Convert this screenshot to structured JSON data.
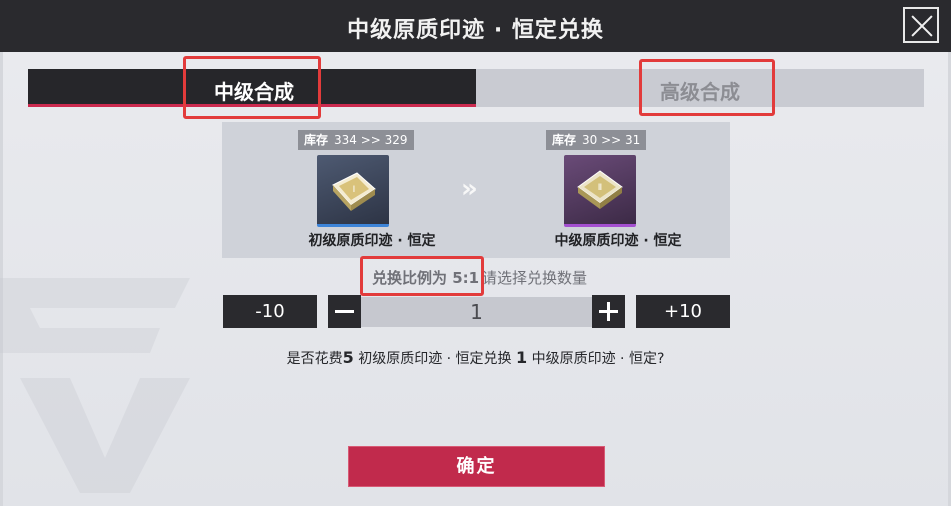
{
  "header": {
    "title": "中级原质印迹 · 恒定兑换"
  },
  "tabs": [
    {
      "label": "中级合成",
      "active": true
    },
    {
      "label": "高级合成",
      "active": false
    }
  ],
  "source_item": {
    "stock_label": "库存",
    "stock_change": "334 >> 329",
    "name": "初级原质印迹 · 恒定",
    "rarity_color": "#3d84d8"
  },
  "target_item": {
    "stock_label": "库存",
    "stock_change": "30 >> 31",
    "name": "中级原质印迹 · 恒定",
    "rarity_color": "#a44fd0"
  },
  "arrow_glyph": "»",
  "exchange": {
    "ratio_text": "兑换比例为 5:1",
    "hint_text": "请选择兑换数量"
  },
  "quantity": {
    "minus10": "-10",
    "plus10": "+10",
    "value": "1"
  },
  "confirmation": {
    "prefix": "是否花费",
    "cost_amount": "5",
    "cost_item": "初级原质印迹 · 恒定兑换",
    "gain_amount": "1",
    "gain_item": "中级原质印迹 · 恒定?"
  },
  "confirm_button": {
    "label": "确定"
  },
  "colors": {
    "accent": "#c12a4c",
    "highlight_box": "#e23b3b",
    "dark": "#2a2a2e"
  }
}
